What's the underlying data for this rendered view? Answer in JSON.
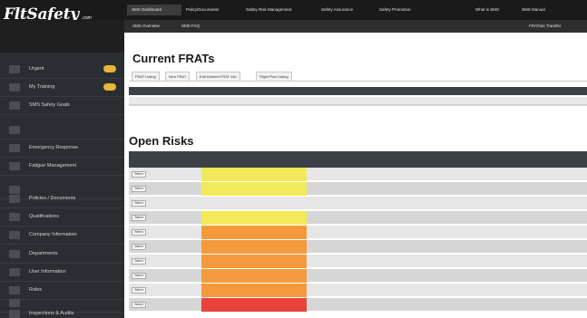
{
  "header": {
    "logo_text": "FltSafety",
    "logo_suffix": ".com",
    "nav_items": [
      "SMS Dashboard",
      "Policy/Documents",
      "Safety Risk Management",
      "Safety Assurance",
      "Safety Promotion",
      "What is SMS",
      "SMS Manual",
      ""
    ],
    "sub_nav_left": [
      "SMS Overview",
      "SMS FAQ"
    ],
    "sub_nav_right": [
      "FRAT/an Transfer",
      ""
    ]
  },
  "account": {
    "line1": "",
    "line2": ""
  },
  "sidebar": {
    "items": [
      {
        "label": "Urgent",
        "badge": "",
        "icon": "alert-icon"
      },
      {
        "label": "My Training",
        "badge": "",
        "icon": "training-icon"
      },
      {
        "label": "SMS Safety Goals",
        "badge": "",
        "icon": "goals-icon"
      },
      {
        "label": "",
        "badge": "",
        "icon": "report-icon"
      },
      {
        "label": "Emergency Response",
        "badge": "",
        "icon": "emergency-icon"
      },
      {
        "label": "Fatigue Management",
        "badge": "",
        "icon": "fatigue-icon"
      },
      {
        "label": "",
        "badge": "",
        "icon": "blank-icon"
      },
      {
        "label": "Policies / Documents",
        "badge": "",
        "icon": "documents-icon"
      },
      {
        "label": "Qualifications",
        "badge": "",
        "icon": "qualifications-icon"
      },
      {
        "label": "Company Information",
        "badge": "",
        "icon": "company-icon"
      },
      {
        "label": "Departments",
        "badge": "",
        "icon": "departments-icon"
      },
      {
        "label": "User Information",
        "badge": "",
        "icon": "user-icon"
      },
      {
        "label": "Roles",
        "badge": "",
        "icon": "roles-icon"
      },
      {
        "label": "",
        "badge": "",
        "icon": "blank-icon"
      },
      {
        "label": "Inspections & Audits",
        "badge": "",
        "icon": "audit-icon"
      }
    ]
  },
  "frats": {
    "title": "Current FRATs",
    "top_right": "",
    "tabs": [
      "FRAT Listing",
      "New FRAT",
      "Edit Deleted FRAT Info",
      "Flight Plan Listing"
    ],
    "columns": [
      "",
      "",
      "",
      "",
      "",
      "",
      "",
      "",
      "",
      "",
      "",
      "",
      "",
      ""
    ],
    "row": [
      "",
      "",
      "",
      "",
      "",
      "",
      "",
      "",
      "",
      "",
      "",
      "",
      "",
      ""
    ]
  },
  "risks": {
    "title": "Open Risks",
    "columns": [
      "",
      "",
      "",
      "",
      "",
      "",
      "",
      "",
      "",
      "",
      "",
      ""
    ],
    "rows": [
      {
        "button": "Select",
        "risk_color": "#f2ea5a",
        "cells": [
          "",
          "",
          "",
          "",
          "",
          "",
          "",
          "",
          "",
          "",
          "",
          ""
        ]
      },
      {
        "button": "Select",
        "risk_color": "#f2ea5a",
        "cells": [
          "",
          "",
          "",
          "",
          "",
          "",
          "",
          "",
          "",
          "",
          "",
          ""
        ]
      },
      {
        "button": "Select",
        "risk_color": "",
        "cells": [
          "",
          "",
          "",
          "",
          "",
          "",
          "",
          "",
          "",
          "",
          "",
          ""
        ]
      },
      {
        "button": "Select",
        "risk_color": "#f2ea5a",
        "cells": [
          "",
          "",
          "",
          "",
          "",
          "",
          "",
          "",
          "",
          "",
          "",
          ""
        ]
      },
      {
        "button": "Select",
        "risk_color": "#f59a3c",
        "cells": [
          "",
          "",
          "",
          "",
          "",
          "",
          "",
          "",
          "",
          "",
          "",
          ""
        ]
      },
      {
        "button": "Select",
        "risk_color": "#f59a3c",
        "cells": [
          "",
          "",
          "",
          "",
          "",
          "",
          "",
          "",
          "",
          "",
          "",
          ""
        ]
      },
      {
        "button": "Select",
        "risk_color": "#f59a3c",
        "cells": [
          "",
          "",
          "",
          "",
          "",
          "",
          "",
          "",
          "",
          "",
          "",
          ""
        ]
      },
      {
        "button": "Select",
        "risk_color": "#f59a3c",
        "cells": [
          "",
          "",
          "",
          "",
          "",
          "",
          "",
          "",
          "",
          "",
          "",
          ""
        ]
      },
      {
        "button": "Select",
        "risk_color": "#f59a3c",
        "cells": [
          "",
          "",
          "",
          "",
          "",
          "",
          "",
          "",
          "",
          "",
          "",
          ""
        ]
      },
      {
        "button": "Select",
        "risk_color": "#e8423a",
        "cells": [
          "",
          "",
          "",
          "",
          "",
          "",
          "",
          "",
          "",
          "",
          "",
          ""
        ]
      }
    ]
  },
  "colors": {
    "sidebar_bg": "#2a2d31",
    "topbar_bg": "#1a1a1a",
    "badge": "#e8b53a",
    "risk_low": "#f2ea5a",
    "risk_medium": "#f59a3c",
    "risk_high": "#e8423a"
  }
}
